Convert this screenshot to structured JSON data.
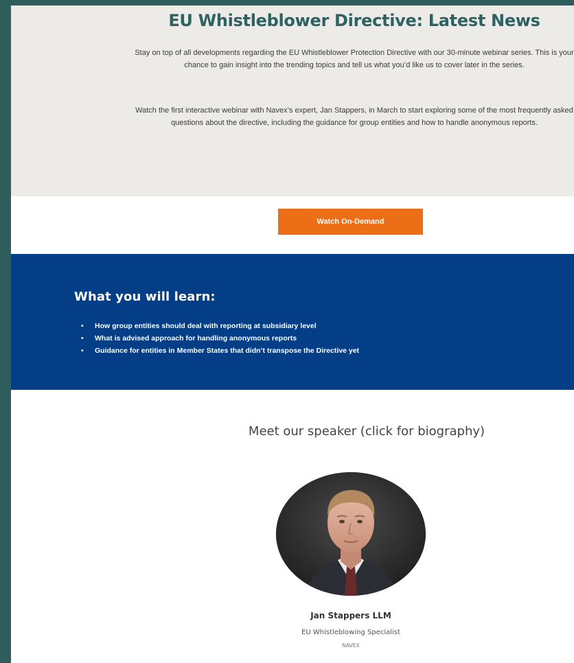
{
  "hero": {
    "title": "EU Whistleblower Directive: Latest News",
    "paragraph_1": "Stay on top of all developments regarding the EU Whistleblower Protection Directive with our 30-minute webinar series. This is your chance to gain insight into the trending topics and tell us what you’d like us to cover later in the series.",
    "paragraph_2": "Watch the first interactive webinar with Navex’s expert, Jan Stappers, in March to start exploring some of the most frequently asked questions about the directive, including the guidance for group entities and how to handle anonymous reports."
  },
  "cta": {
    "label": "Watch On-Demand",
    "color": "#ec6f18"
  },
  "learn": {
    "title": "What you will learn:",
    "items": [
      "How group entities should deal with reporting at subsidiary level",
      "What is advised approach for handling anonymous reports",
      "Guidance for entities in Member States that didn’t transpose the Directive yet"
    ],
    "bullet": "•",
    "background": "#033e87"
  },
  "speaker": {
    "heading": "Meet our speaker (click for biography)",
    "name": "Jan Stappers LLM",
    "role": "EU Whistleblowing Specialist",
    "organization": "NAVEX",
    "photo_icon": "speaker-portrait"
  },
  "colors": {
    "page_background": "#2f5d5c",
    "hero_background": "#ecebe8",
    "title_color": "#2e6161"
  }
}
